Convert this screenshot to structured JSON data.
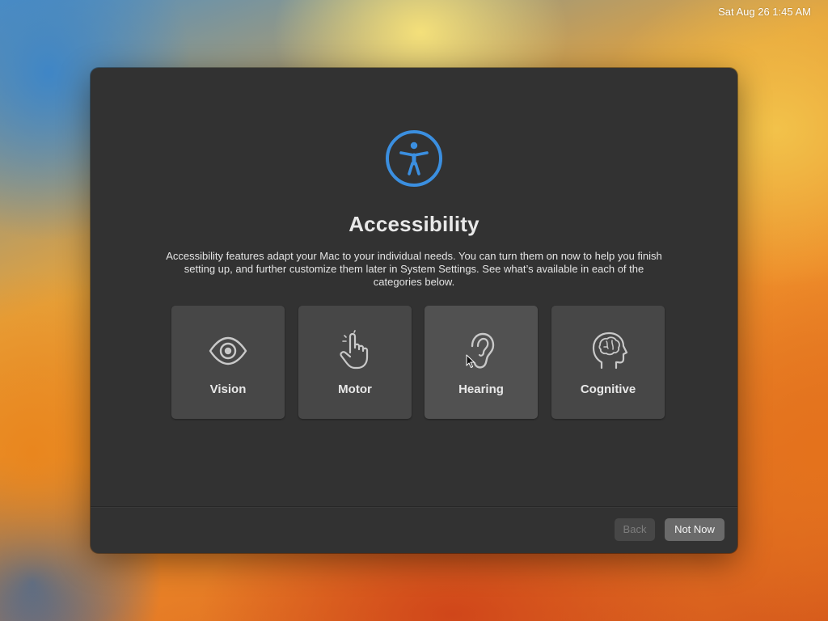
{
  "menubar": {
    "clock": "Sat Aug 26  1:45 AM"
  },
  "setup": {
    "icon": "accessibility-icon",
    "accent_color": "#3b8fe0",
    "title": "Accessibility",
    "description": "Accessibility features adapt your Mac to your individual needs. You can turn them on now to help you finish setting up, and further customize them later in System Settings. See what’s available in each of the categories below.",
    "categories": [
      {
        "label": "Vision",
        "icon": "eye-icon"
      },
      {
        "label": "Motor",
        "icon": "pointing-hand-icon"
      },
      {
        "label": "Hearing",
        "icon": "ear-icon"
      },
      {
        "label": "Cognitive",
        "icon": "brain-head-icon"
      }
    ],
    "buttons": {
      "back": "Back",
      "not_now": "Not Now"
    }
  }
}
